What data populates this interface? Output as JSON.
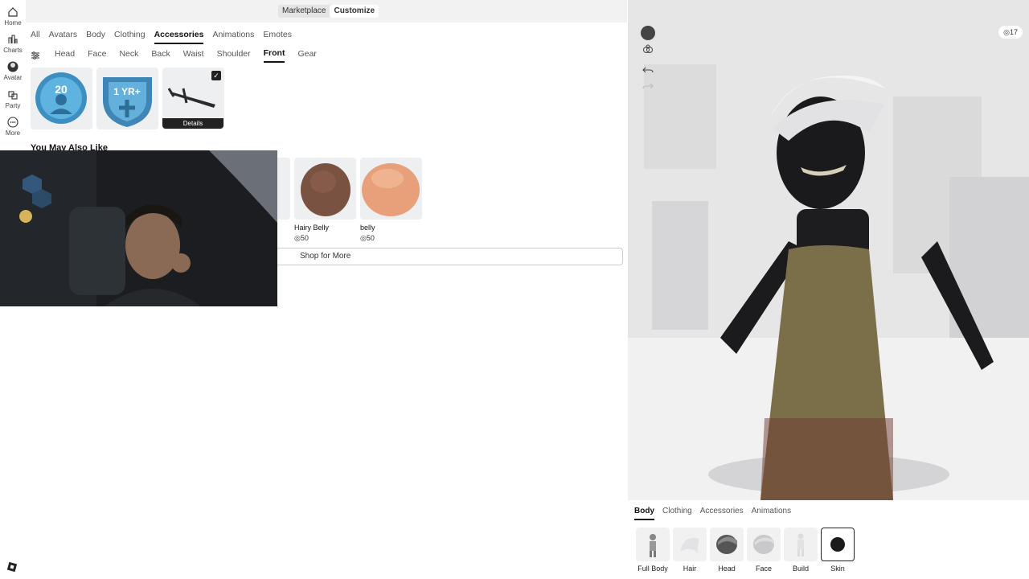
{
  "nav": {
    "items": [
      {
        "label": "Home",
        "icon": "home-icon"
      },
      {
        "label": "Charts",
        "icon": "charts-icon"
      },
      {
        "label": "Avatar",
        "icon": "avatar-icon"
      },
      {
        "label": "Party",
        "icon": "party-icon"
      },
      {
        "label": "More",
        "icon": "more-icon"
      }
    ]
  },
  "topbar": {
    "marketplace_label": "Marketplace",
    "customize_label": "Customize"
  },
  "category_tabs": [
    "All",
    "Avatars",
    "Body",
    "Clothing",
    "Accessories",
    "Animations",
    "Emotes"
  ],
  "category_active": "Accessories",
  "subcategory_tabs": [
    "Head",
    "Face",
    "Neck",
    "Back",
    "Waist",
    "Shoulder",
    "Front",
    "Gear"
  ],
  "subcategory_active": "Front",
  "owned_items": [
    {
      "badge_text": "20"
    },
    {
      "badge_text": "1 YR+"
    },
    {
      "badge_text": "",
      "selected": true
    }
  ],
  "details_label": "Details",
  "recommend": {
    "title": "You May Also Like",
    "items": [
      {
        "name": "Hairy Belly",
        "price": "◎50"
      },
      {
        "name": "belly",
        "price": "◎50"
      }
    ],
    "shop_more_label": "Shop for More"
  },
  "viewport": {
    "robux": "◎17"
  },
  "bottom_panel": {
    "tabs": [
      "Body",
      "Clothing",
      "Accessories",
      "Animations"
    ],
    "active_tab": "Body",
    "items": [
      {
        "label": "Full Body"
      },
      {
        "label": "Hair"
      },
      {
        "label": "Head"
      },
      {
        "label": "Face"
      },
      {
        "label": "Build"
      },
      {
        "label": "Skin",
        "selected": true
      }
    ]
  },
  "colors": {
    "accent": "#111111",
    "panel_bg": "#eeeff1",
    "viewport_bg": "#e9e9ea"
  }
}
